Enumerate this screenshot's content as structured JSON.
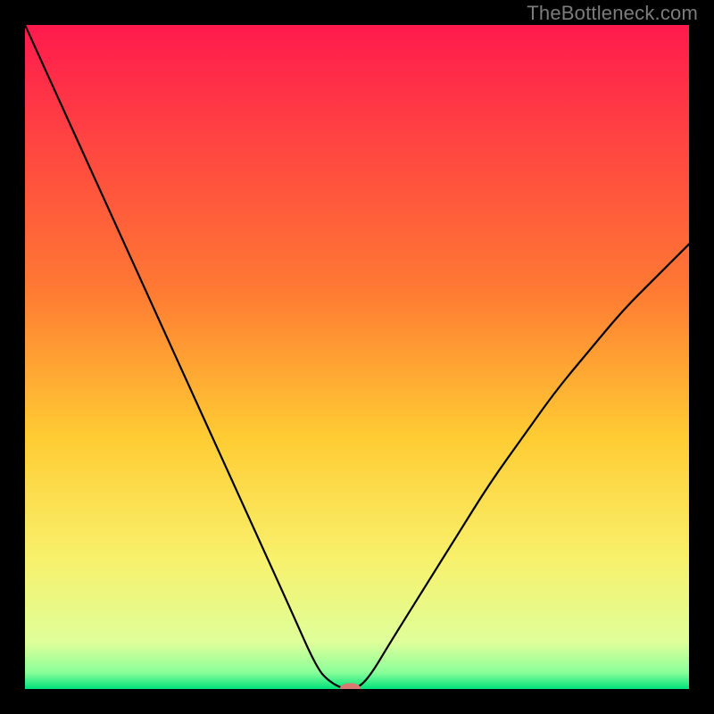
{
  "watermark": "TheBottleneck.com",
  "chart_data": {
    "type": "line",
    "title": "",
    "xlabel": "",
    "ylabel": "",
    "xlim": [
      0,
      100
    ],
    "ylim": [
      0,
      100
    ],
    "grid": false,
    "legend": false,
    "gradient_stops": [
      {
        "offset": 0,
        "color": "#ff1a4d"
      },
      {
        "offset": 0.4,
        "color": "#ff7a33"
      },
      {
        "offset": 0.62,
        "color": "#ffcc33"
      },
      {
        "offset": 0.8,
        "color": "#f8f06a"
      },
      {
        "offset": 0.93,
        "color": "#dfff9a"
      },
      {
        "offset": 0.975,
        "color": "#8aff9a"
      },
      {
        "offset": 1.0,
        "color": "#00e27a"
      }
    ],
    "series": [
      {
        "name": "bottleneck-curve",
        "x": [
          0,
          5,
          10,
          15,
          20,
          25,
          30,
          35,
          40,
          44,
          46,
          48,
          50,
          52,
          55,
          60,
          65,
          70,
          75,
          80,
          85,
          90,
          95,
          100
        ],
        "values": [
          100,
          89,
          78,
          67,
          56,
          45,
          34,
          23,
          12,
          3,
          1,
          0,
          0,
          2,
          7,
          15,
          23,
          31,
          38,
          45,
          51,
          57,
          62,
          67
        ]
      }
    ],
    "marker": {
      "x": 49,
      "y": 0,
      "rx": 1.6,
      "ry": 0.9
    }
  }
}
